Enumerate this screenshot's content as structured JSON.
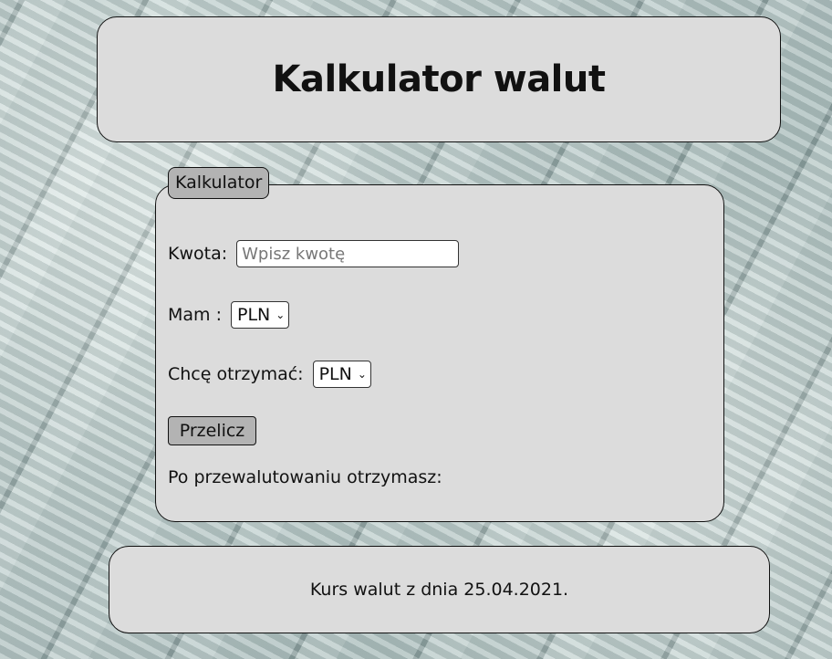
{
  "header": {
    "title": "Kalkulator walut"
  },
  "calculator": {
    "legend": "Kalkulator",
    "amount": {
      "label": "Kwota:",
      "placeholder": "Wpisz kwotę",
      "value": ""
    },
    "have": {
      "label": "Mam :",
      "selected": "PLN"
    },
    "want": {
      "label": "Chcę otrzymać:",
      "selected": "PLN"
    },
    "convert_label": "Przelicz",
    "result_label": "Po przewalutowaniu otrzymasz:"
  },
  "footer": {
    "text": "Kurs walut z dnia 25.04.2021."
  }
}
